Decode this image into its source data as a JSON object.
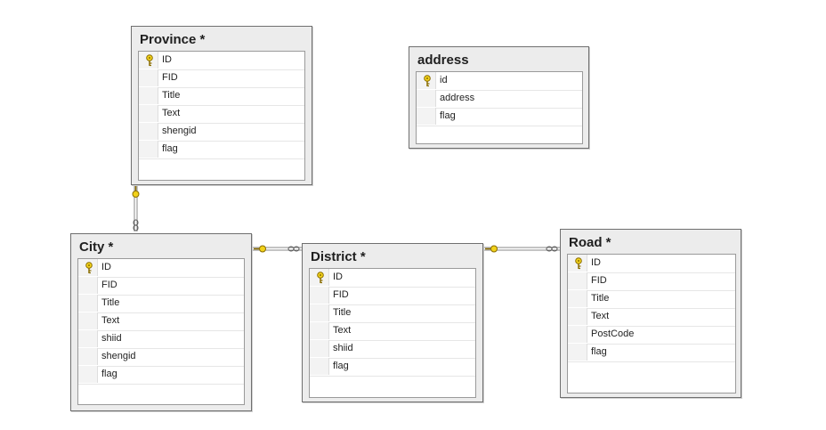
{
  "tables": {
    "province": {
      "title": "Province *",
      "columns": [
        "ID",
        "FID",
        "Title",
        "Text",
        "shengid",
        "flag"
      ],
      "key_column": "ID"
    },
    "address": {
      "title": "address",
      "columns": [
        "id",
        "address",
        "flag"
      ],
      "key_column": "id"
    },
    "city": {
      "title": "City *",
      "columns": [
        "ID",
        "FID",
        "Title",
        "Text",
        "shiid",
        "shengid",
        "flag"
      ],
      "key_column": "ID"
    },
    "district": {
      "title": "District *",
      "columns": [
        "ID",
        "FID",
        "Title",
        "Text",
        "shiid",
        "flag"
      ],
      "key_column": "ID"
    },
    "road": {
      "title": "Road *",
      "columns": [
        "ID",
        "FID",
        "Title",
        "Text",
        "PostCode",
        "flag"
      ],
      "key_column": "ID"
    }
  },
  "relationships": [
    {
      "from": "province",
      "to": "city",
      "type": "one-to-many"
    },
    {
      "from": "district",
      "to": "city",
      "type": "one-to-many"
    },
    {
      "from": "district",
      "to": "road",
      "type": "one-to-many"
    }
  ],
  "colors": {
    "line": "#8a8a8a",
    "key_fill": "#f2d21a",
    "key_stroke": "#8a6d00"
  }
}
